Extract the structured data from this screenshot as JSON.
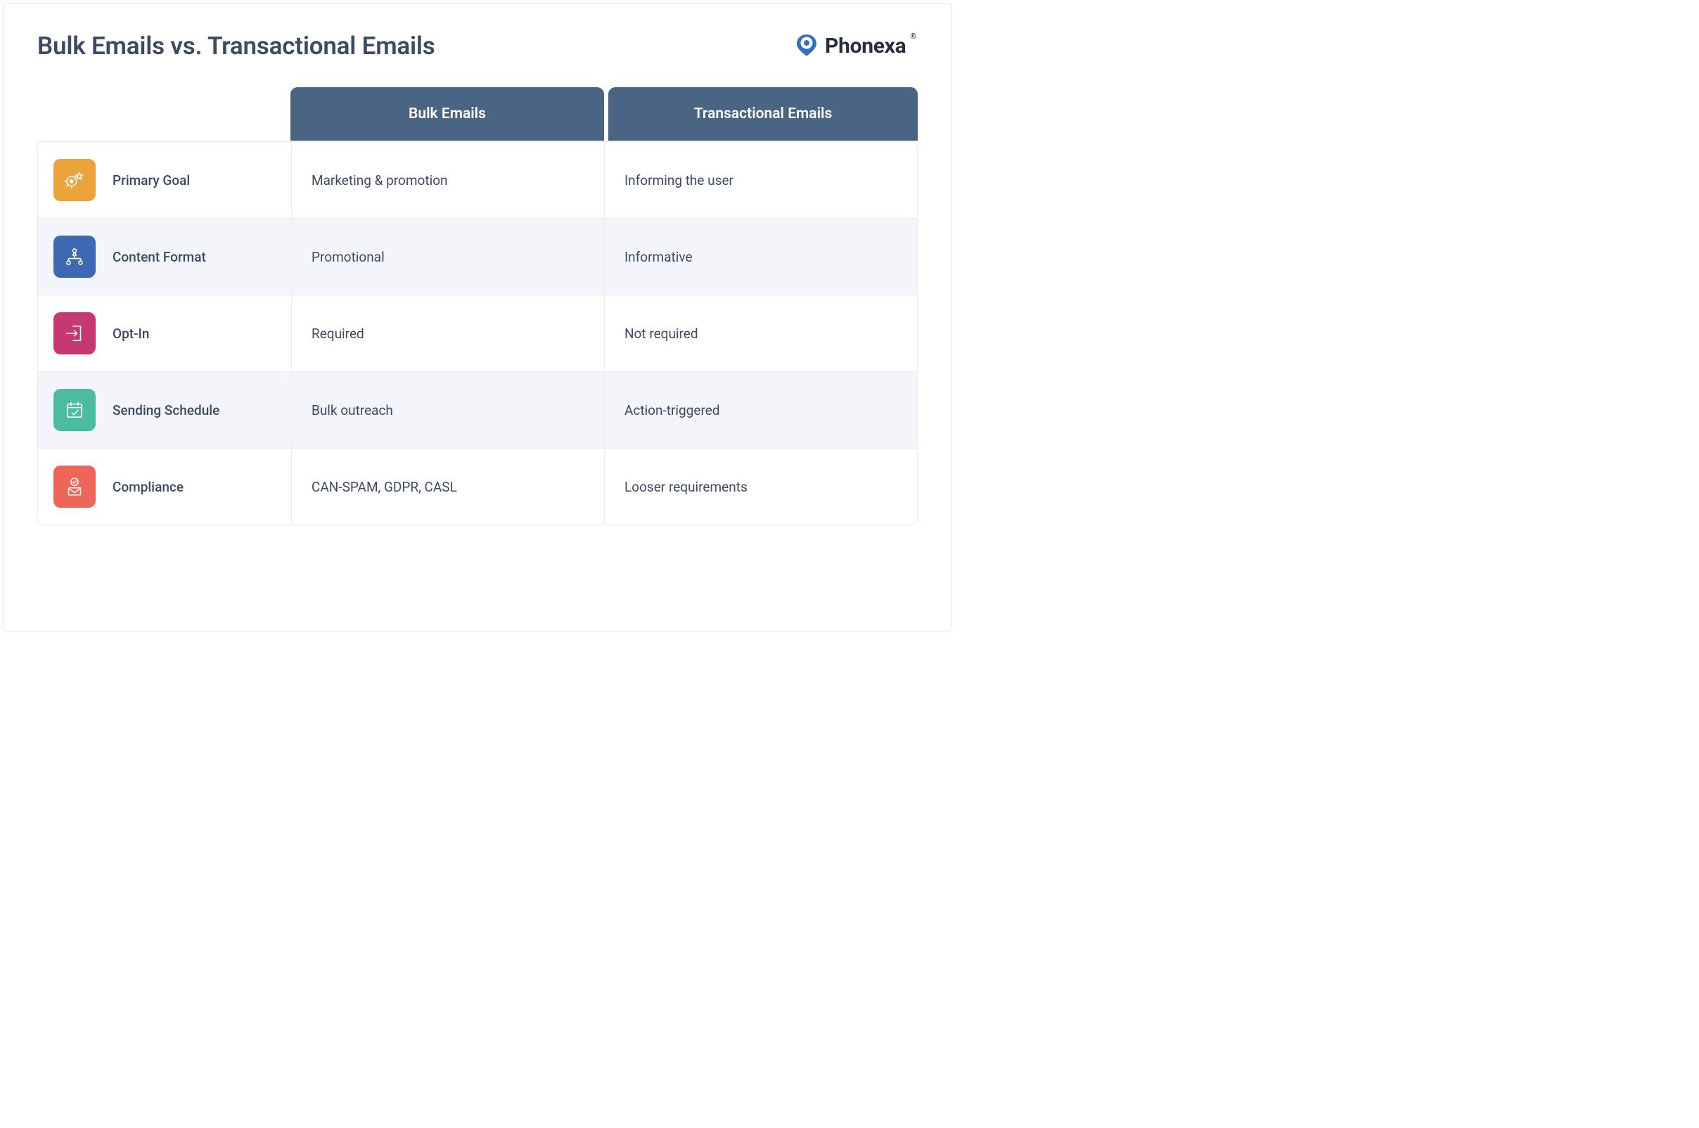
{
  "title": "Bulk Emails vs. Transactional Emails",
  "brand": {
    "name": "Phonexa"
  },
  "columns": {
    "a": "Bulk Emails",
    "b": "Transactional Emails"
  },
  "rows": [
    {
      "label": "Primary Goal",
      "a": "Marketing & promotion",
      "b": "Informing the user"
    },
    {
      "label": "Content Format",
      "a": "Promotional",
      "b": "Informative"
    },
    {
      "label": "Opt-In",
      "a": "Required",
      "b": "Not required"
    },
    {
      "label": "Sending Schedule",
      "a": "Bulk outreach",
      "b": "Action-triggered"
    },
    {
      "label": "Compliance",
      "a": "CAN-SPAM, GDPR, CASL",
      "b": "Looser requirements"
    }
  ]
}
